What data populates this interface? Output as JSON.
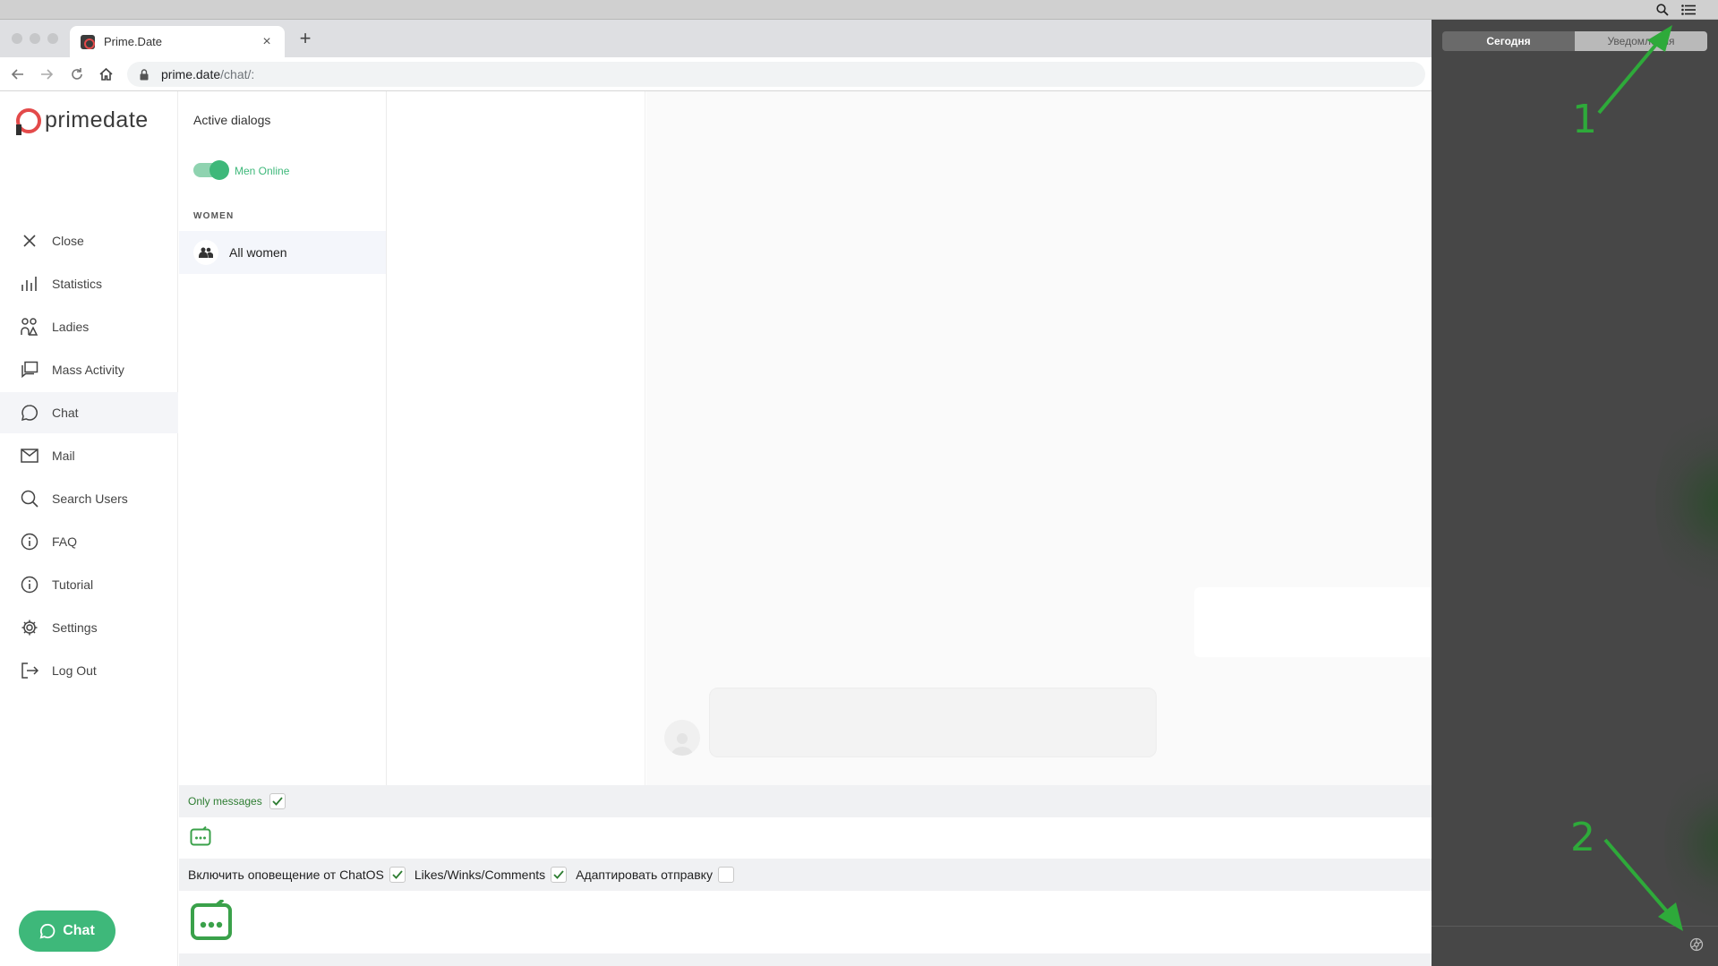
{
  "browser": {
    "tab_title": "Prime.Date",
    "tab_close": "×",
    "new_tab": "+",
    "url_host": "prime.date",
    "url_path": "/chat/:"
  },
  "app": {
    "logo_text": "primedate",
    "nav": [
      {
        "label": "Close",
        "icon": "close-icon"
      },
      {
        "label": "Statistics",
        "icon": "bar-chart-icon"
      },
      {
        "label": "Ladies",
        "icon": "ladies-icon"
      },
      {
        "label": "Mass Activity",
        "icon": "mass-activity-icon"
      },
      {
        "label": "Chat",
        "icon": "chat-bubble-icon"
      },
      {
        "label": "Mail",
        "icon": "mail-icon"
      },
      {
        "label": "Search Users",
        "icon": "search-icon"
      },
      {
        "label": "FAQ",
        "icon": "info-icon"
      },
      {
        "label": "Tutorial",
        "icon": "info-icon"
      },
      {
        "label": "Settings",
        "icon": "gear-icon"
      },
      {
        "label": "Log Out",
        "icon": "logout-icon"
      }
    ],
    "chat_button": "Chat",
    "dialogs": {
      "title": "Active dialogs",
      "toggle_label": "Men Online",
      "section": "WOMEN",
      "all_women": "All women"
    },
    "bottom": {
      "only_messages": "Only messages",
      "opt1": "Включить оповещение от ChatOS",
      "opt2": "Likes/Winks/Comments",
      "opt3": "Адаптировать отправку"
    },
    "colors": {
      "accent": "#3eb87a",
      "logo_red": "#e34a4a"
    }
  },
  "notification_center": {
    "tab_today": "Сегодня",
    "tab_notifications": "Уведомления",
    "annotation_1": "1",
    "annotation_2": "2"
  }
}
